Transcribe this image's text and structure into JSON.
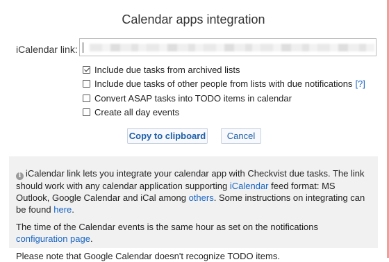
{
  "dialog": {
    "title": "Calendar apps integration",
    "ical_label": "iCalendar link:",
    "ical_value": ""
  },
  "options": [
    {
      "label": "Include due tasks from archived lists",
      "checked": true
    },
    {
      "label": "Include due tasks of other people from lists with due notifications",
      "checked": false,
      "help": "[?]"
    },
    {
      "label": "Convert ASAP tasks into TODO items in calendar",
      "checked": false
    },
    {
      "label": "Create all day events",
      "checked": false
    }
  ],
  "buttons": {
    "copy": "Copy to clipboard",
    "cancel": "Cancel"
  },
  "info": {
    "icon": "info-icon",
    "p1_a": "iCalendar link lets you integrate your calendar app with Checkvist due tasks. The link should work with any calendar application supporting ",
    "p1_link1": "iCalendar",
    "p1_b": " feed format: MS Outlook, Google Calendar and iCal among ",
    "p1_link2": "others",
    "p1_c": ". Some instructions on integrating can be found ",
    "p1_link3": "here",
    "p1_d": ".",
    "p2_a": "The time of the Calendar events is the same hour as set on the notifications ",
    "p2_link": "configuration page",
    "p2_b": ".",
    "p3": "Please note that Google Calendar doesn't recognize TODO items."
  },
  "colors": {
    "link": "#1a66c4",
    "info_bg": "#f1f1f1"
  }
}
